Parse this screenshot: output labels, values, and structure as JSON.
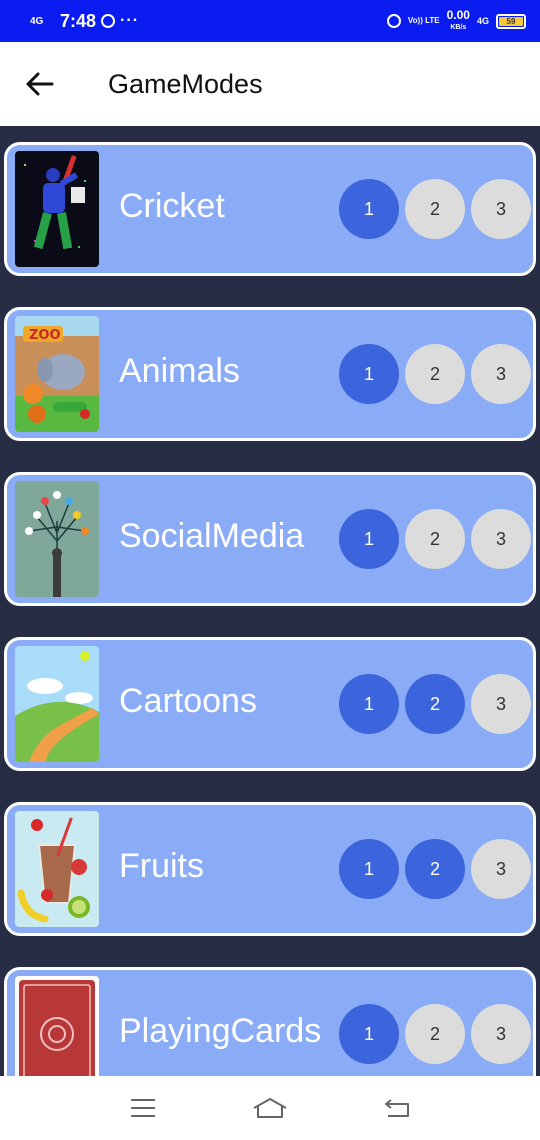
{
  "status_bar": {
    "network": "4G",
    "time": "7:48",
    "net_label": "Vo)) LTE",
    "speed": "0.00",
    "speed_unit": "KB/s",
    "network_right": "4G",
    "battery": "59"
  },
  "header": {
    "title": "GameModes"
  },
  "modes": [
    {
      "label": "Cricket",
      "levels": [
        "1",
        "2",
        "3"
      ],
      "unlocked": 1
    },
    {
      "label": "Animals",
      "levels": [
        "1",
        "2",
        "3"
      ],
      "unlocked": 1
    },
    {
      "label": "SocialMedia",
      "levels": [
        "1",
        "2",
        "3"
      ],
      "unlocked": 1
    },
    {
      "label": "Cartoons",
      "levels": [
        "1",
        "2",
        "3"
      ],
      "unlocked": 2
    },
    {
      "label": "Fruits",
      "levels": [
        "1",
        "2",
        "3"
      ],
      "unlocked": 2
    },
    {
      "label": "PlayingCards",
      "levels": [
        "1",
        "2",
        "3"
      ],
      "unlocked": 1
    }
  ],
  "colors": {
    "status_bar": "#0a1cf0",
    "background": "#262d44",
    "card": "#8aabf5",
    "level_active": "#3c64dc",
    "level_inactive": "#dcdcdc"
  }
}
